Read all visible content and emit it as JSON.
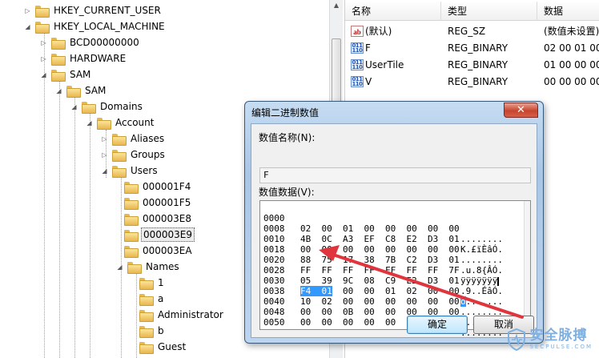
{
  "tree": {
    "items": [
      {
        "label": "HKEY_CURRENT_USER",
        "expander": "▷"
      },
      {
        "label": "HKEY_LOCAL_MACHINE",
        "expander": "◢"
      },
      {
        "label": "BCD00000000",
        "expander": "▷"
      },
      {
        "label": "HARDWARE",
        "expander": "▷"
      },
      {
        "label": "SAM",
        "expander": "◢"
      },
      {
        "label": "SAM",
        "expander": "◢"
      },
      {
        "label": "Domains",
        "expander": "◢"
      },
      {
        "label": "Account",
        "expander": "◢"
      },
      {
        "label": "Aliases",
        "expander": "▷"
      },
      {
        "label": "Groups",
        "expander": "▷"
      },
      {
        "label": "Users",
        "expander": "◢"
      },
      {
        "label": "000001F4",
        "expander": ""
      },
      {
        "label": "000001F5",
        "expander": ""
      },
      {
        "label": "000003E8",
        "expander": ""
      },
      {
        "label": "000003E9",
        "expander": "",
        "selected": true
      },
      {
        "label": "000003EA",
        "expander": ""
      },
      {
        "label": "Names",
        "expander": "◢"
      },
      {
        "label": "1",
        "expander": ""
      },
      {
        "label": "a",
        "expander": ""
      },
      {
        "label": "Administrator",
        "expander": ""
      },
      {
        "label": "b",
        "expander": ""
      },
      {
        "label": "Guest",
        "expander": ""
      }
    ]
  },
  "list": {
    "headers": [
      "名称",
      "类型",
      "数据"
    ],
    "rows": [
      {
        "icon": "string-value-icon",
        "name": "(默认)",
        "type": "REG_SZ",
        "data": "(数值未设置)"
      },
      {
        "icon": "binary-value-icon",
        "name": "F",
        "type": "REG_BINARY",
        "data": "02 00 01 00"
      },
      {
        "icon": "binary-value-icon",
        "name": "UserTile",
        "type": "REG_BINARY",
        "data": "01 00 00 00"
      },
      {
        "icon": "binary-value-icon",
        "name": "V",
        "type": "REG_BINARY",
        "data": "00 00 00 00"
      }
    ]
  },
  "dialog": {
    "title": "编辑二进制数值",
    "close_glyph": "✕",
    "name_label": "数值名称(N):",
    "name_value": "F",
    "data_label": "数值数据(V):",
    "hex_rows": [
      {
        "offset": "0000",
        "bytes": "02  00  01  00  00  00  00  00",
        "ascii": "........"
      },
      {
        "offset": "0008",
        "bytes": "4B  0C  A3  EF  C8  E2  D3  01",
        "ascii": "K.£ïÈâÓ."
      },
      {
        "offset": "0010",
        "bytes": "00  00  00  00  00  00  00  00",
        "ascii": "........"
      },
      {
        "offset": "0018",
        "bytes": "88  75  17  38  7B  C2  D3  01",
        "ascii": ".u.8{ÂÓ."
      },
      {
        "offset": "0020",
        "bytes": "FF  FF  FF  FF  FF  FF  FF  7F",
        "ascii": "ÿÿÿÿÿÿÿ"
      },
      {
        "offset": "0028",
        "bytes": "05  39  9C  08  C9  E2  D3  01",
        "ascii": ".9..ÉâÓ."
      },
      {
        "offset": "0030",
        "hl": "F4  01",
        "bytes": "  00  00  01  02  00  00",
        "hl_ascii": "ô",
        "ascii": ".......",
        "selected": true
      },
      {
        "offset": "0038",
        "bytes": "10  02  00  00  00  00  00  00",
        "ascii": "........"
      },
      {
        "offset": "0040",
        "bytes": "00  00  0B  00  00  00  00  00",
        "ascii": "........"
      },
      {
        "offset": "0048",
        "bytes": "00  00  00  00  00  00  00  00",
        "ascii": "........"
      },
      {
        "offset": "0050",
        "bytes": "",
        "ascii": ""
      }
    ],
    "ok_label": "确定",
    "cancel_label": "取消"
  },
  "watermark": {
    "cn": "安全脉搏",
    "en": "SECPULSE.COM"
  },
  "colors": {
    "highlight": "#3399ff",
    "arrow": "#e0353c",
    "folder": "#f2c75c"
  }
}
